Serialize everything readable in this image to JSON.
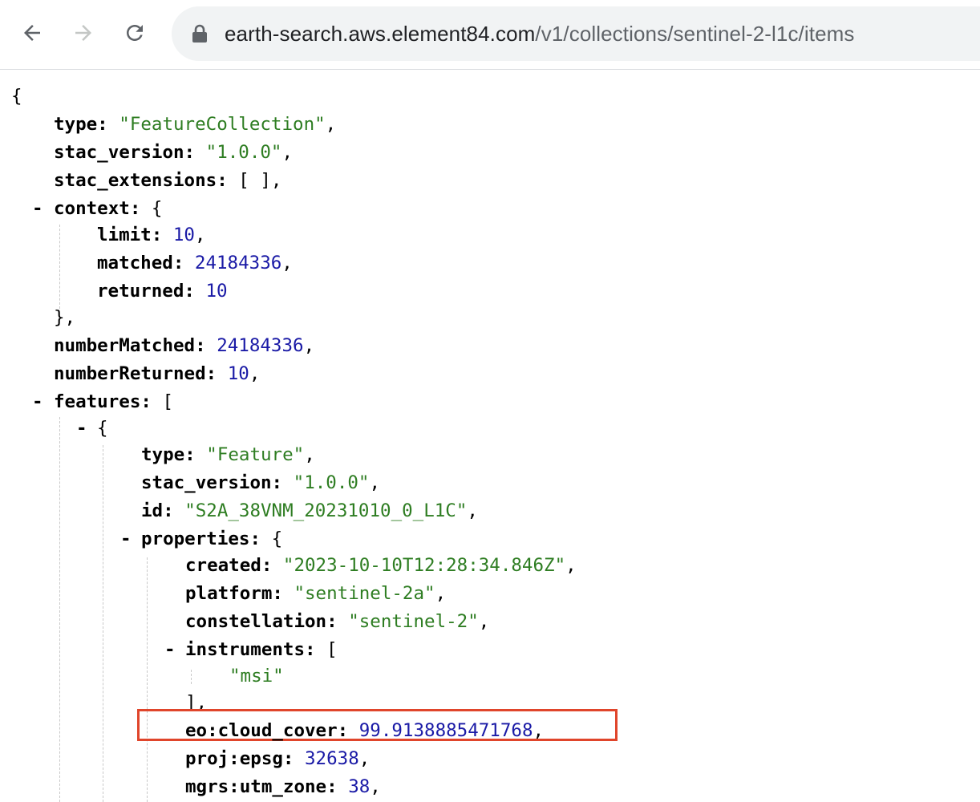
{
  "browser": {
    "back_icon": "arrow-left-icon",
    "forward_icon": "arrow-right-icon",
    "reload_icon": "reload-icon",
    "lock_icon": "lock-icon",
    "url_host": "earth-search.aws.element84.com",
    "url_path": "/v1/collections/sentinel-2-l1c/items"
  },
  "json": {
    "open_brace": "{",
    "type_key": "type:",
    "type_val": "\"FeatureCollection\"",
    "stac_version_key": "stac_version:",
    "stac_version_val": "\"1.0.0\"",
    "stac_extensions_key": "stac_extensions:",
    "stac_extensions_val": "[ ],",
    "context_key": "context:",
    "limit_key": "limit:",
    "limit_val": "10",
    "matched_key": "matched:",
    "matched_val": "24184336",
    "returned_key": "returned:",
    "returned_val": "10",
    "close_context": "},",
    "numberMatched_key": "numberMatched:",
    "numberMatched_val": "24184336",
    "numberReturned_key": "numberReturned:",
    "numberReturned_val": "10",
    "features_key": "features:",
    "feature": {
      "type_key": "type:",
      "type_val": "\"Feature\"",
      "stac_version_key": "stac_version:",
      "stac_version_val": "\"1.0.0\"",
      "id_key": "id:",
      "id_val": "\"S2A_38VNM_20231010_0_L1C\"",
      "properties_key": "properties:",
      "created_key": "created:",
      "created_val": "\"2023-10-10T12:28:34.846Z\"",
      "platform_key": "platform:",
      "platform_val": "\"sentinel-2a\"",
      "constellation_key": "constellation:",
      "constellation_val": "\"sentinel-2\"",
      "instruments_key": "instruments:",
      "instrument_0": "\"msi\"",
      "close_instruments": "],",
      "cloud_cover_key": "eo:cloud_cover:",
      "cloud_cover_val": "99.9138885471768",
      "epsg_key": "proj:epsg:",
      "epsg_val": "32638",
      "utm_zone_key": "mgrs:utm_zone:",
      "utm_zone_val": "38"
    }
  },
  "colors": {
    "key": "#000000",
    "string": "#2e7d22",
    "number": "#1a1aa6",
    "highlight_border": "#e0452b"
  }
}
